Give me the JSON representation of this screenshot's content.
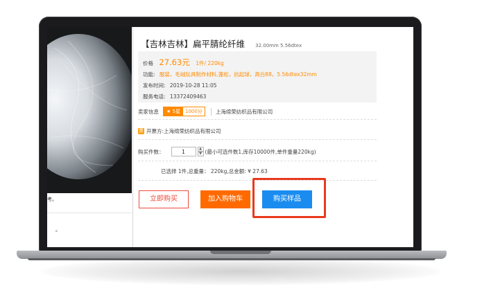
{
  "product": {
    "title": "【吉林吉林】扁平腈纶纤维",
    "spec": "32.00mm 5.56dtex"
  },
  "info": {
    "price_label": "价格",
    "price_value": "27.63元",
    "unit_qty": "1件/ 220kg",
    "function_label": "功能:",
    "function_value": "服装，毛绒玩具制作材料,蓬松，抗起球，高白88，5.56dtex32mm",
    "publish_label": "发布时间:",
    "publish_value": "2019-10-28 11:05",
    "phone_label": "服务电话:",
    "phone_value": "13372409463"
  },
  "seller": {
    "label": "卖家信息",
    "level": "5星",
    "points": "1000分",
    "name": "上海绵荣纺织品有限公司"
  },
  "invoice": {
    "text": "开票方:上海绵荣纺织品有限公司"
  },
  "quantity": {
    "label": "购买件数：",
    "value": "1",
    "note": "(最小可选件数1,库存10000件,单件重量220kg)"
  },
  "summary": {
    "text": "已选择 1件,总重量： 220kg,总金额: ¥  27.63"
  },
  "image_area": {
    "caption": "考。",
    "dot": "。"
  },
  "buttons": {
    "buy_now": "立即购买",
    "add_cart": "加入购物车",
    "buy_sample": "购买样品"
  },
  "colors": {
    "accent_orange": "#ff8a00",
    "cart_orange": "#ff6a00",
    "buy_red": "#f04a3a",
    "sample_blue": "#1a8cf0",
    "highlight_red": "#e83a1e"
  }
}
